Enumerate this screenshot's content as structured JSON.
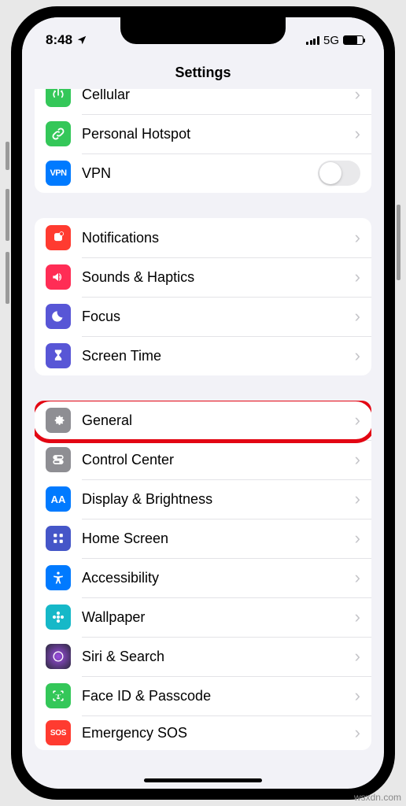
{
  "status": {
    "time": "8:48",
    "network": "5G"
  },
  "header": {
    "title": "Settings"
  },
  "groups": [
    {
      "rows": [
        {
          "label": "Cellular",
          "icon": "antenna-icon",
          "color": "#34c759",
          "action": "chevron"
        },
        {
          "label": "Personal Hotspot",
          "icon": "link-icon",
          "color": "#34c759",
          "action": "chevron"
        },
        {
          "label": "VPN",
          "icon": "vpn-icon",
          "color": "#007aff",
          "action": "toggle"
        }
      ]
    },
    {
      "rows": [
        {
          "label": "Notifications",
          "icon": "bell-icon",
          "color": "#ff3b30",
          "action": "chevron"
        },
        {
          "label": "Sounds & Haptics",
          "icon": "speaker-icon",
          "color": "#ff2d55",
          "action": "chevron"
        },
        {
          "label": "Focus",
          "icon": "moon-icon",
          "color": "#5856d6",
          "action": "chevron"
        },
        {
          "label": "Screen Time",
          "icon": "hourglass-icon",
          "color": "#5856d6",
          "action": "chevron"
        }
      ]
    },
    {
      "rows": [
        {
          "label": "General",
          "icon": "gear-icon",
          "color": "#8e8e93",
          "action": "chevron",
          "highlighted": true
        },
        {
          "label": "Control Center",
          "icon": "switches-icon",
          "color": "#8e8e93",
          "action": "chevron"
        },
        {
          "label": "Display & Brightness",
          "icon": "text-size-icon",
          "color": "#007aff",
          "action": "chevron"
        },
        {
          "label": "Home Screen",
          "icon": "grid-icon",
          "color": "#4556c8",
          "action": "chevron"
        },
        {
          "label": "Accessibility",
          "icon": "accessibility-icon",
          "color": "#007aff",
          "action": "chevron"
        },
        {
          "label": "Wallpaper",
          "icon": "flower-icon",
          "color": "#16b8c8",
          "action": "chevron"
        },
        {
          "label": "Siri & Search",
          "icon": "siri-icon",
          "color": "#1b1b2b",
          "action": "chevron"
        },
        {
          "label": "Face ID & Passcode",
          "icon": "faceid-icon",
          "color": "#34c759",
          "action": "chevron"
        },
        {
          "label": "Emergency SOS",
          "icon": "sos-icon",
          "color": "#ff3b30",
          "action": "chevron"
        }
      ]
    }
  ],
  "watermark": "wsxdn.com"
}
